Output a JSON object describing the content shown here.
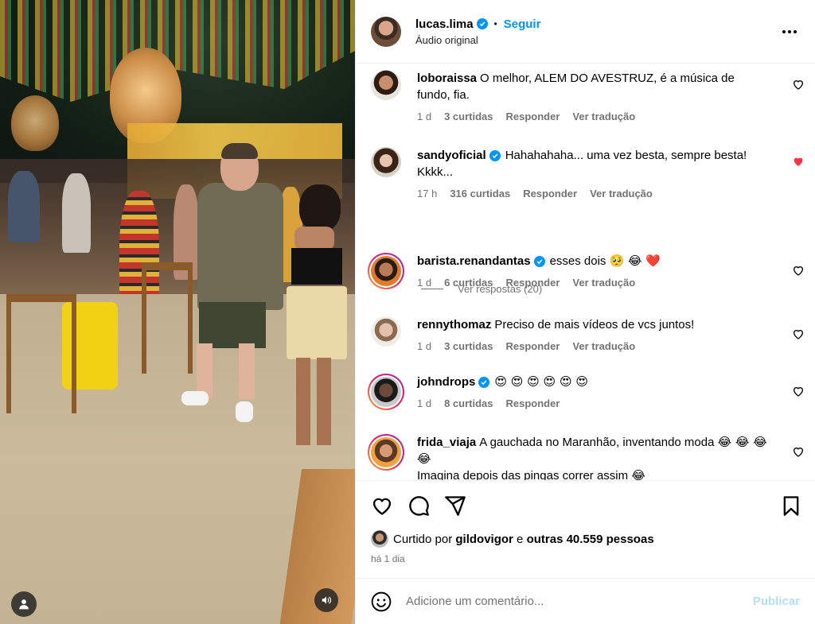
{
  "post": {
    "author": "lucas.lima",
    "separator": "•",
    "follow_label": "Seguir",
    "audio_label": "Áudio original"
  },
  "comments": [
    {
      "username": "loboraissa",
      "text": "O melhor, ALEM DO AVESTRUZ, é a música de fundo, fia.",
      "time": "1 d",
      "likes": "3 curtidas",
      "reply": "Responder",
      "translate": "Ver tradução",
      "verified": false,
      "liked": false
    },
    {
      "username": "sandyoficial",
      "text": "Hahahahaha... uma vez besta, sempre besta! Kkkk...",
      "time": "17 h",
      "likes": "316 curtidas",
      "reply": "Responder",
      "translate": "Ver tradução",
      "verified": true,
      "liked": true
    },
    {
      "username": "barista.renandantas",
      "text": "esses dois",
      "emoji": "🥺 😂 ❤️",
      "time": "1 d",
      "likes": "6 curtidas",
      "reply": "Responder",
      "translate": "Ver tradução",
      "verified": true,
      "liked": false
    },
    {
      "username": "rennythomaz",
      "text": "Preciso de mais vídeos de vcs juntos!",
      "time": "1 d",
      "likes": "3 curtidas",
      "reply": "Responder",
      "translate": "Ver tradução",
      "verified": false,
      "liked": false
    },
    {
      "username": "johndrops",
      "text": "",
      "emoji": "😍 😍 😍 😍 😍 😍",
      "time": "1 d",
      "likes": "8 curtidas",
      "reply": "Responder",
      "verified": true,
      "liked": false
    },
    {
      "username": "frida_viaja",
      "text": "A gauchada no Maranhão, inventando moda",
      "emoji": "😂 😂 😂 😂",
      "text2": "Imagina depois das pingas correr assim",
      "emoji2": "😂",
      "verified": false,
      "liked": false
    }
  ],
  "view_replies": "Ver respostas (20)",
  "likes_summary": {
    "prefix": "Curtido por",
    "user": "gildovigor",
    "conj": "e",
    "others": "outras 40.559 pessoas"
  },
  "posted_ago": "há 1 dia",
  "composer": {
    "placeholder": "Adicione um comentário...",
    "publish_label": "Publicar"
  },
  "colors": {
    "accent": "#0095f6",
    "like_red": "#ff3040",
    "meta_gray": "#737373",
    "publish_disabled": "#b2dffc"
  },
  "icons": [
    "heart-icon",
    "comment-icon",
    "share-icon",
    "bookmark-icon",
    "emoji-icon",
    "more-icon",
    "verified-icon",
    "user-icon",
    "volume-icon"
  ]
}
